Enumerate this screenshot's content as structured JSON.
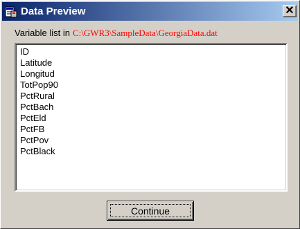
{
  "window": {
    "title": "Data Preview",
    "close_glyph": "✕",
    "icon": "data-preview-app-icon"
  },
  "path": {
    "label": "Variable list in",
    "value": "C:\\GWR3\\SampleData\\GeorgiaData.dat",
    "value_color": "#ff0000"
  },
  "variables": [
    "ID",
    "Latitude",
    "Longitud",
    "TotPop90",
    "PctRural",
    "PctBach",
    "PctEld",
    "PctFB",
    "PctPov",
    "PctBlack"
  ],
  "buttons": {
    "continue_label": "Continue"
  },
  "colors": {
    "titlebar_start": "#0a246a",
    "titlebar_end": "#a6caf0",
    "face": "#d4d0c8"
  }
}
